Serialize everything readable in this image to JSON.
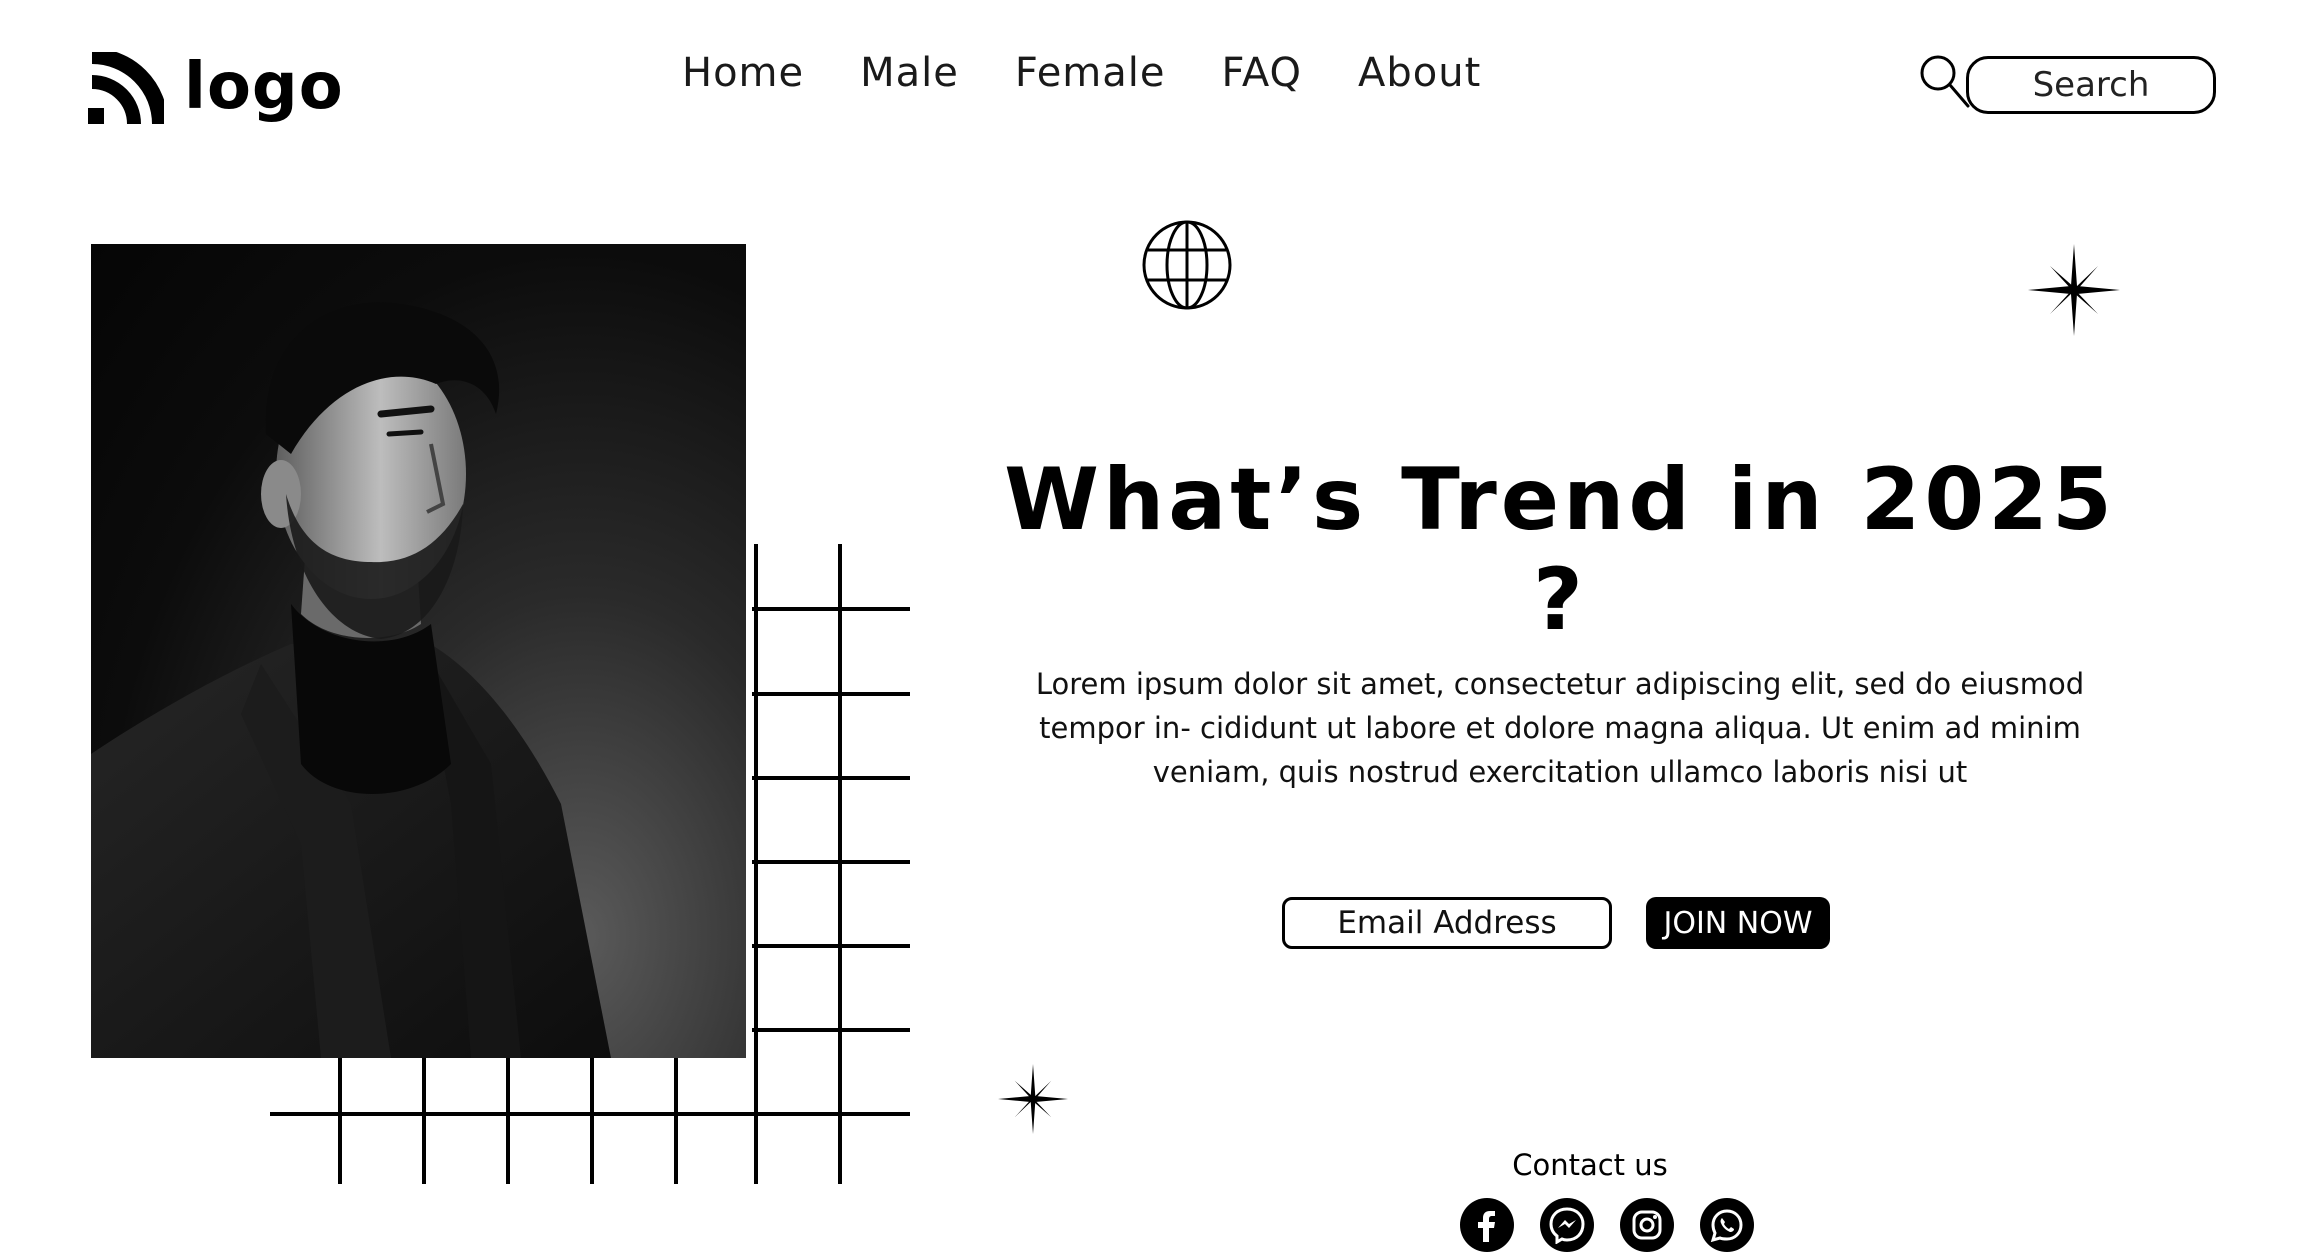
{
  "header": {
    "logo_text": "logo",
    "nav": [
      "Home",
      "Male",
      "Female",
      "FAQ",
      "About"
    ],
    "search_placeholder": "Search"
  },
  "hero": {
    "headline": "What’s Trend in 2025 ?",
    "body": "Lorem ipsum dolor sit amet, consectetur adipiscing elit, sed do eiusmod tempor in- cididunt ut labore et dolore magna aliqua. Ut enim ad minim veniam, quis nostrud exercitation ullamco laboris nisi ut",
    "email_placeholder": "Email Address",
    "join_label": "JOIN NOW"
  },
  "contact": {
    "label": "Contact us",
    "socials": [
      "facebook-icon",
      "messenger-icon",
      "instagram-icon",
      "whatsapp-icon"
    ]
  },
  "colors": {
    "primary": "#000000",
    "background": "#ffffff"
  }
}
